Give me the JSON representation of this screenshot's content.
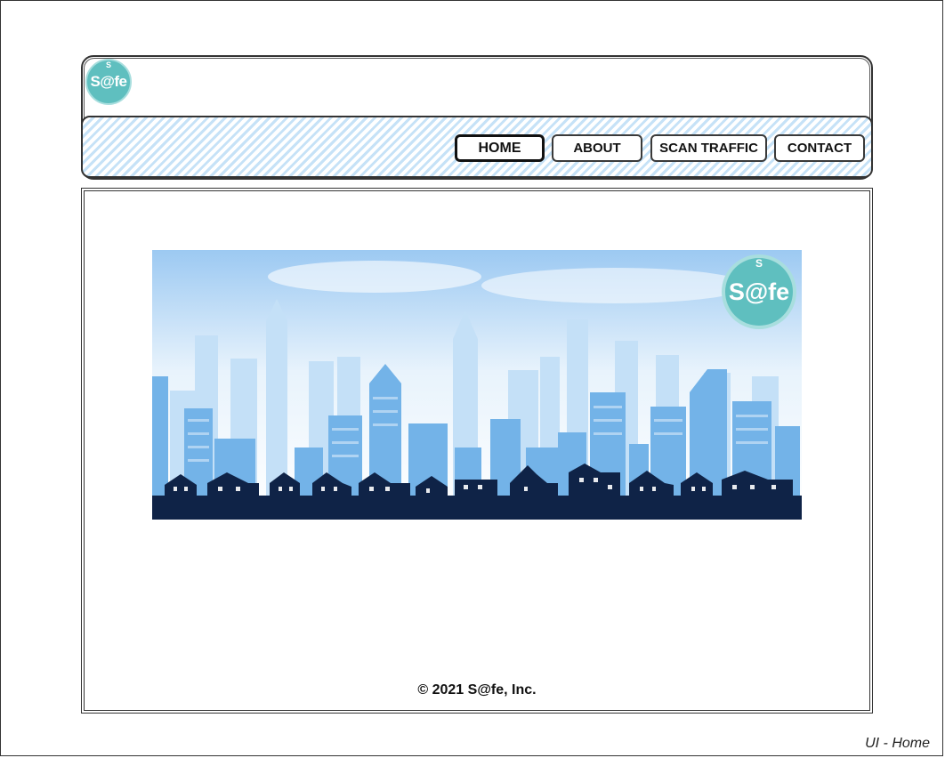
{
  "brand": {
    "logo_small": "S",
    "logo_word": "S@fe"
  },
  "nav": {
    "home": "HOME",
    "about": "ABOUT",
    "scan": "SCAN TRAFFIC",
    "contact": "CONTACT",
    "active": "home"
  },
  "hero": {
    "logo_small": "S",
    "logo_word": "S@fe"
  },
  "footer": {
    "copyright": "© 2021 S@fe, Inc."
  },
  "caption": "UI - Home",
  "colors": {
    "accent_teal": "#5fbfbf",
    "nav_stripe": "#c6e2f7",
    "sky_top": "#9cc9f2",
    "building_light": "#b5d8f5",
    "building_mid": "#6aaee6",
    "house_dark": "#0f2347"
  }
}
